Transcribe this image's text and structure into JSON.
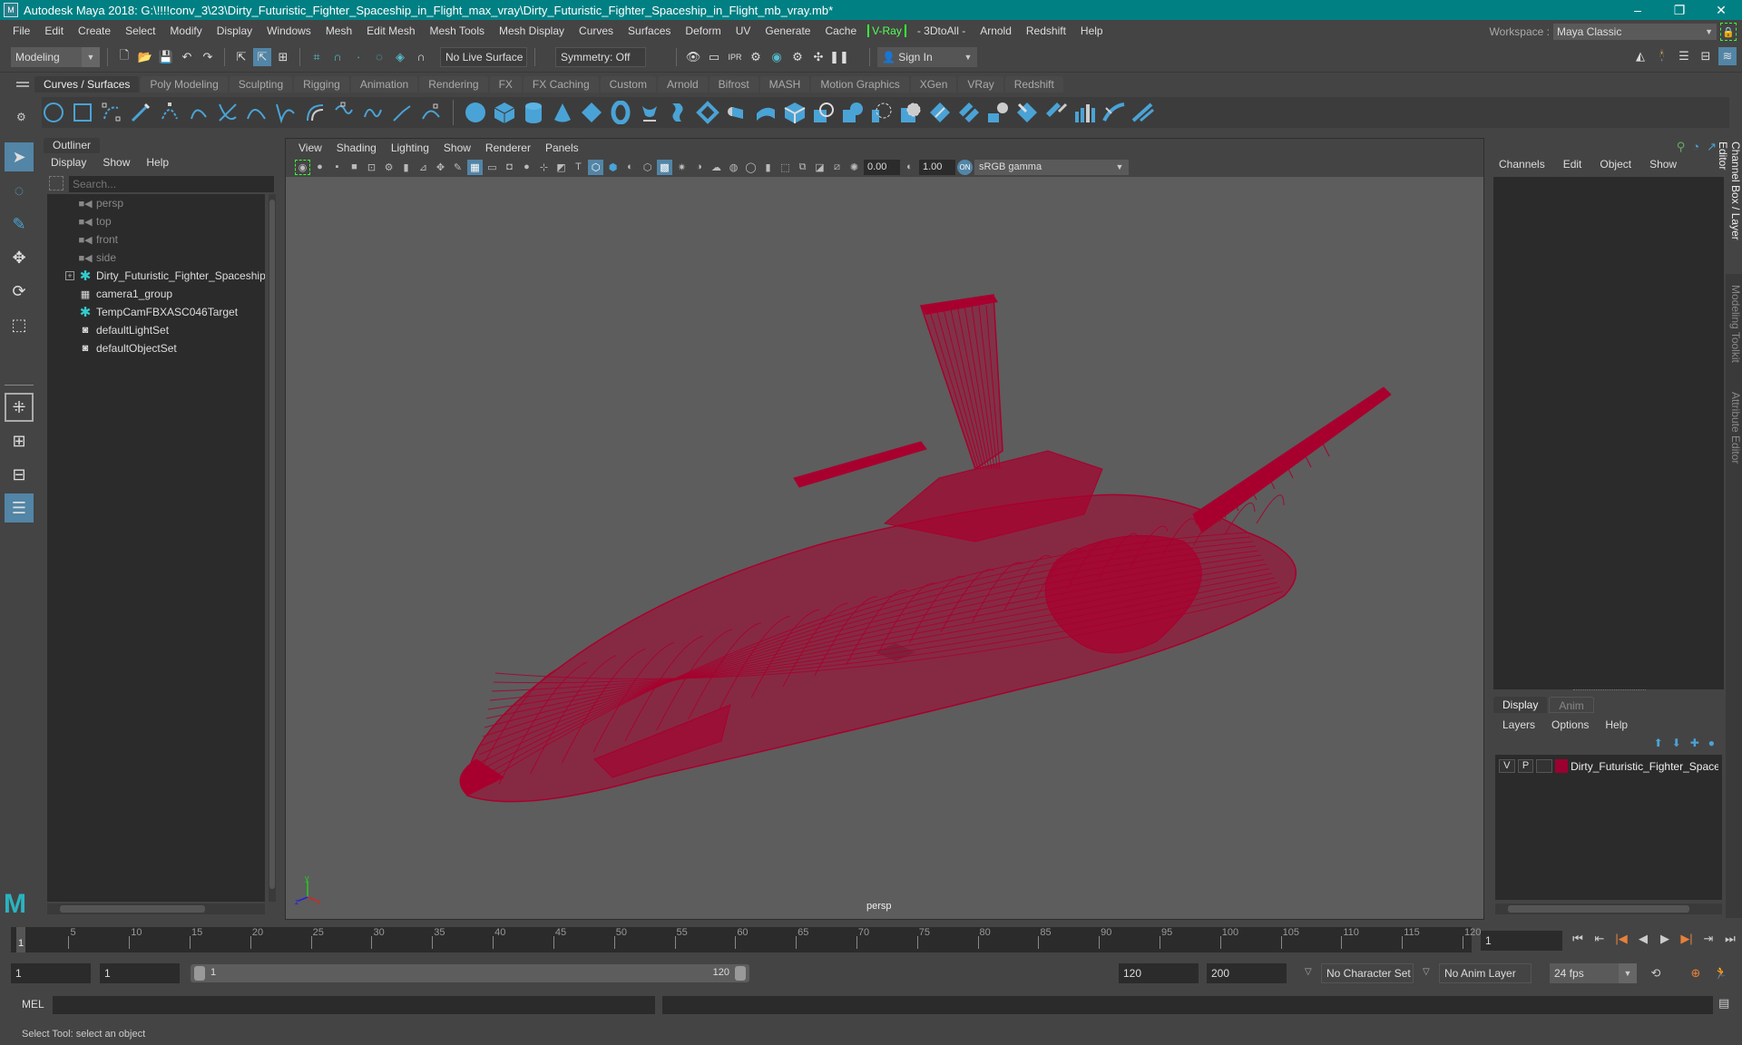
{
  "window": {
    "title": "Autodesk Maya 2018: G:\\!!!!conv_3\\23\\Dirty_Futuristic_Fighter_Spaceship_in_Flight_max_vray\\Dirty_Futuristic_Fighter_Spaceship_in_Flight_mb_vray.mb*",
    "controls": {
      "minimize": "–",
      "maximize": "❐",
      "close": "✕"
    }
  },
  "menubar": {
    "items": [
      "File",
      "Edit",
      "Create",
      "Select",
      "Modify",
      "Display",
      "Windows",
      "Mesh",
      "Edit Mesh",
      "Mesh Tools",
      "Mesh Display",
      "Curves",
      "Surfaces",
      "Deform",
      "UV",
      "Generate",
      "Cache"
    ],
    "vray": "V-Ray",
    "items_after": [
      "- 3DtoAll -",
      "Arnold",
      "Redshift",
      "Help"
    ],
    "workspace_label": "Workspace :",
    "workspace_value": "Maya Classic"
  },
  "statusline": {
    "mode": "Modeling",
    "live_surface": "No Live Surface",
    "symmetry": "Symmetry: Off",
    "sign_in": "Sign In"
  },
  "shelf": {
    "tabs": [
      "Curves / Surfaces",
      "Poly Modeling",
      "Sculpting",
      "Rigging",
      "Animation",
      "Rendering",
      "FX",
      "FX Caching",
      "Custom",
      "Arnold",
      "Bifrost",
      "MASH",
      "Motion Graphics",
      "XGen",
      "VRay",
      "Redshift"
    ],
    "active_tab": "Curves / Surfaces"
  },
  "outliner": {
    "tab": "Outliner",
    "menu": [
      "Display",
      "Show",
      "Help"
    ],
    "search_placeholder": "Search...",
    "items": [
      {
        "label": "persp",
        "icon": "camera-icon",
        "dim": true
      },
      {
        "label": "top",
        "icon": "camera-icon",
        "dim": true
      },
      {
        "label": "front",
        "icon": "camera-icon",
        "dim": true
      },
      {
        "label": "side",
        "icon": "camera-icon",
        "dim": true
      },
      {
        "label": "Dirty_Futuristic_Fighter_Spaceship_in_Flight",
        "icon": "transform-icon",
        "expandable": true
      },
      {
        "label": "camera1_group",
        "icon": "group-icon"
      },
      {
        "label": "TempCamFBXASC046Target",
        "icon": "transform-icon"
      },
      {
        "label": "defaultLightSet",
        "icon": "set-icon"
      },
      {
        "label": "defaultObjectSet",
        "icon": "set-icon"
      }
    ]
  },
  "viewport": {
    "menu": [
      "View",
      "Shading",
      "Lighting",
      "Show",
      "Renderer",
      "Panels"
    ],
    "exposure": "0.00",
    "gamma": "1.00",
    "color_space": "sRGB gamma",
    "camera": "persp",
    "wireframe_color": "#a8002e",
    "axis": {
      "x": "x",
      "y": "y",
      "z": "z"
    }
  },
  "channelbox": {
    "menu": [
      "Channels",
      "Edit",
      "Object",
      "Show"
    ],
    "layer_tabs": [
      "Display",
      "Anim"
    ],
    "active_layer_tab": "Display",
    "layer_menu": [
      "Layers",
      "Options",
      "Help"
    ],
    "layer": {
      "v": "V",
      "p": "P",
      "name": "Dirty_Futuristic_Fighter_Spaceship",
      "color": "#9b0031"
    }
  },
  "side_tabs": [
    "Channel Box / Layer Editor",
    "Modeling Toolkit",
    "Attribute Editor"
  ],
  "timeslider": {
    "ticks": [
      5,
      10,
      15,
      20,
      25,
      30,
      35,
      40,
      45,
      50,
      55,
      60,
      65,
      70,
      75,
      80,
      85,
      90,
      95,
      100,
      105,
      110,
      115,
      120
    ],
    "current_frame": "1",
    "current_frame_field": "1",
    "min": 1,
    "max": 120
  },
  "range": {
    "start": "1",
    "playback_start": "1",
    "slider_start": "1",
    "slider_end": "120",
    "playback_end": "120",
    "end": "200",
    "character_set": "No Character Set",
    "anim_layer": "No Anim Layer",
    "fps": "24 fps"
  },
  "commandline": {
    "label": "MEL"
  },
  "helpline": {
    "text": "Select Tool: select an object"
  }
}
